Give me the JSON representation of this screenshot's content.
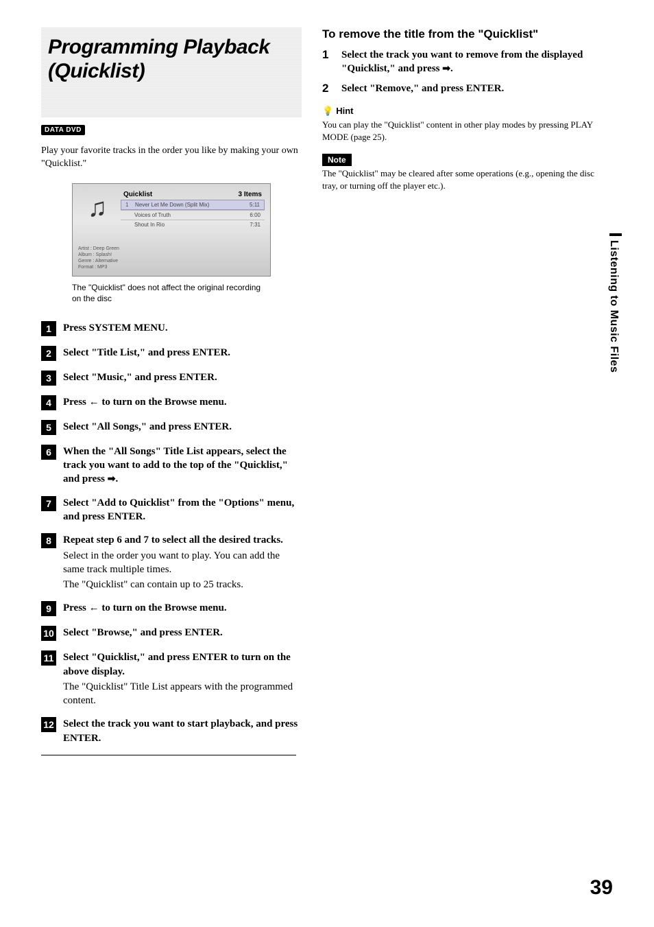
{
  "title": "Programming Playback (Quicklist)",
  "badge": "DATA DVD",
  "intro": "Play your favorite tracks in the order you like by making your own \"Quicklist.\"",
  "screenshot": {
    "header": "Quicklist",
    "count": "3 Items",
    "rows": [
      {
        "n": "1",
        "title": "Never Let Me Down (Split Mix)",
        "dur": "5:11"
      },
      {
        "n": "",
        "title": "Voices of Truth",
        "dur": "6:00"
      },
      {
        "n": "",
        "title": "Shout In Rio",
        "dur": "7:31"
      }
    ],
    "meta": {
      "artist": "Artist : Deep Green",
      "album": "Album  : Splash!",
      "genre": "Genre  : Alternative",
      "format": "Format : MP3"
    }
  },
  "caption": "The \"Quicklist\" does not affect the original recording on the disc",
  "steps": [
    {
      "n": "1",
      "bold": "Press SYSTEM MENU."
    },
    {
      "n": "2",
      "bold": "Select \"Title List,\" and press ENTER."
    },
    {
      "n": "3",
      "bold": "Select \"Music,\" and press ENTER."
    },
    {
      "n": "4",
      "bold": "Press ",
      "arrow": "l",
      "bold2": " to turn on the Browse menu."
    },
    {
      "n": "5",
      "bold": "Select \"All Songs,\" and press ENTER."
    },
    {
      "n": "6",
      "bold": "When the \"All Songs\" Title List appears, select the track you want to add to the top of the \"Quicklist,\" and press ",
      "arrow": "r",
      "bold2": "."
    },
    {
      "n": "7",
      "bold": "Select \"Add to Quicklist\" from the \"Options\" menu, and press ENTER."
    },
    {
      "n": "8",
      "bold": "Repeat step 6 and 7 to select all the desired tracks.",
      "sub": "Select in the order you want to play. You can add the same track multiple times.\nThe \"Quicklist\" can contain up to 25 tracks."
    },
    {
      "n": "9",
      "bold": "Press ",
      "arrow": "l",
      "bold2": " to turn on the Browse menu."
    },
    {
      "n": "10",
      "bold": "Select \"Browse,\" and press ENTER."
    },
    {
      "n": "11",
      "bold": "Select \"Quicklist,\" and press ENTER to turn on the above display.",
      "sub": "The \"Quicklist\" Title List appears with the programmed content."
    },
    {
      "n": "12",
      "bold": "Select the track you want to start playback, and press ENTER."
    }
  ],
  "remove": {
    "heading": "To remove the title from the \"Quicklist\"",
    "steps": [
      {
        "n": "1",
        "text": "Select the track you want to remove from the displayed \"Quicklist,\" and press ",
        "arrow": "r",
        "text2": "."
      },
      {
        "n": "2",
        "text": "Select \"Remove,\" and press ENTER."
      }
    ]
  },
  "hint": {
    "label": "Hint",
    "text": "You can play the \"Quicklist\" content in other play modes by pressing PLAY MODE (page 25)."
  },
  "note": {
    "label": "Note",
    "text": "The \"Quicklist\" may be cleared after some operations (e.g., opening the disc tray, or turning off the player etc.)."
  },
  "sidetab": "Listening to Music Files",
  "pagenum": "39"
}
